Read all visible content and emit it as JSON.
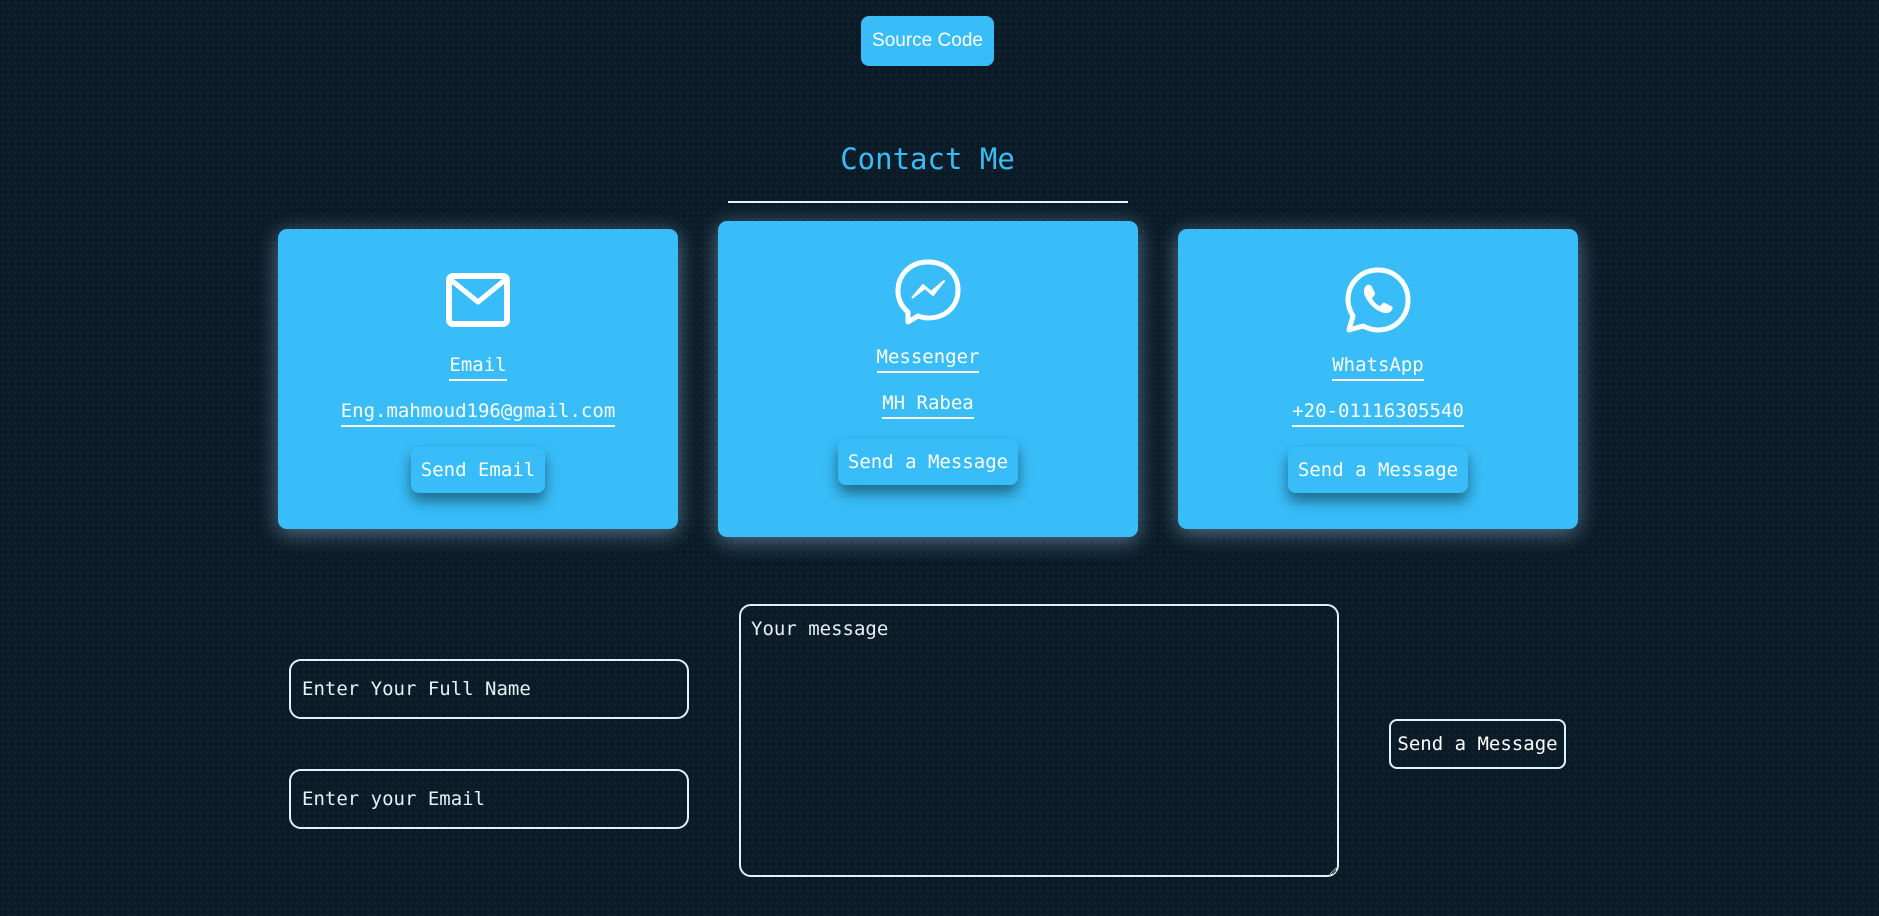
{
  "header": {
    "source_code_label": "Source Code"
  },
  "contact": {
    "title": "Contact Me",
    "cards": [
      {
        "icon": "envelope-icon",
        "label": "Email",
        "value": "Eng.mahmoud196@gmail.com",
        "action": "Send Email"
      },
      {
        "icon": "messenger-icon",
        "label": "Messenger",
        "value": "MH Rabea",
        "action": "Send a Message"
      },
      {
        "icon": "whatsapp-icon",
        "label": "WhatsApp",
        "value": "+20-01116305540",
        "action": "Send a Message"
      }
    ]
  },
  "form": {
    "name_placeholder": "Enter Your Full Name",
    "email_placeholder": "Enter your Email",
    "message_placeholder": "Your message",
    "submit_label": "Send a Message"
  },
  "colors": {
    "background": "#0b1c28",
    "accent": "#38bdf8",
    "text": "#ffffff"
  }
}
